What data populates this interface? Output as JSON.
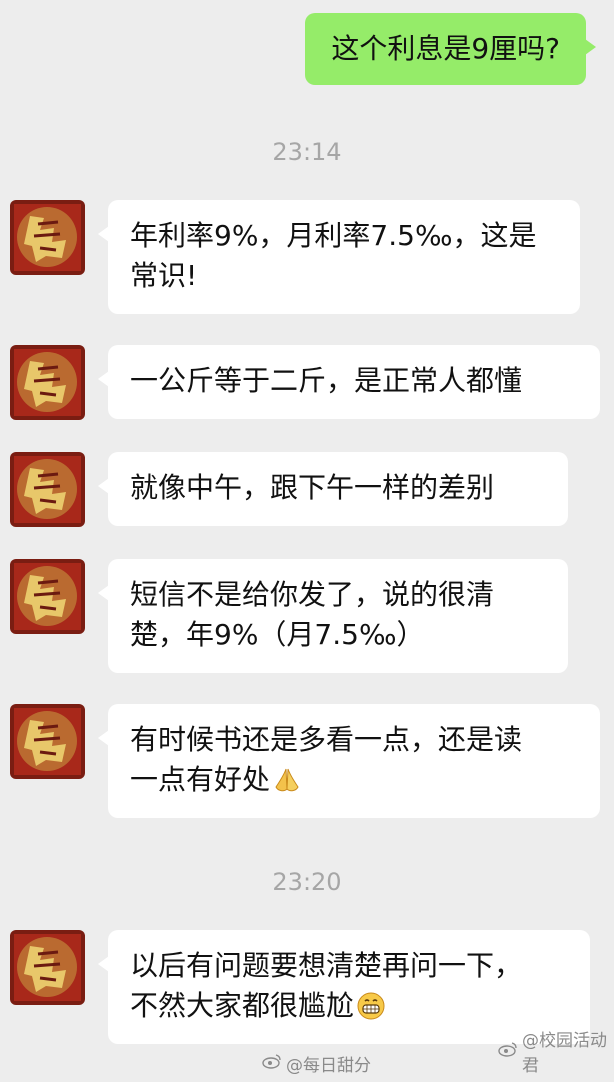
{
  "chat": {
    "sent_message": "这个利息是9厘吗?",
    "timestamp_1": "23:14",
    "timestamp_2": "23:20",
    "received": [
      {
        "lines": [
          "年利率9%，月利率7.5‰，这是",
          "常识!"
        ],
        "emoji": ""
      },
      {
        "lines": [
          "一公斤等于二斤，是正常人都懂"
        ],
        "emoji": ""
      },
      {
        "lines": [
          "就像中午，跟下午一样的差别"
        ],
        "emoji": ""
      },
      {
        "lines": [
          "短信不是给你发了，说的很清",
          "楚，年9%（月7.5‰）"
        ],
        "emoji": ""
      },
      {
        "lines": [
          "有时候书还是多看一点，还是读",
          "一点有好处"
        ],
        "emoji": "pray-hands-emoji"
      },
      {
        "lines": [
          "以后有问题要想清楚再问一下，",
          "不然大家都很尴尬"
        ],
        "emoji": "grin-emoji"
      }
    ],
    "avatar_icon": "fu-character-avatar-icon"
  },
  "watermarks": {
    "left": "@每日甜分",
    "right": "@校园活动君",
    "icon": "weibo-icon"
  },
  "colors": {
    "background": "#ededed",
    "sent_bubble": "#95ec69",
    "received_bubble": "#ffffff",
    "timestamp": "#a6a6a6"
  }
}
